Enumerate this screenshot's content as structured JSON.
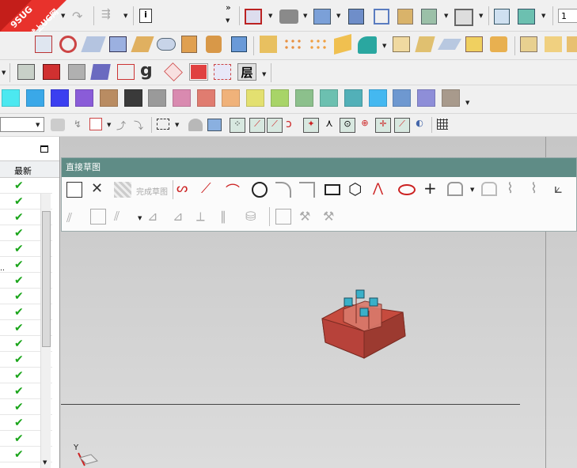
{
  "watermark": {
    "brand": "9SUG",
    "slogan": "学UG就上UG网"
  },
  "toolbar": {
    "layer_input": "1",
    "finish_sketch_label": "完成草图",
    "layer_button_glyph": "层",
    "more_glyph": "»"
  },
  "navigator": {
    "column_latest": "最新"
  },
  "sketch_panel": {
    "title": "直接草图"
  },
  "viewport": {
    "axis_label": "Y"
  },
  "colors": {
    "palette": [
      "#4ce8f0",
      "#3aa8e8",
      "#3b3ff0",
      "#8a5cd8",
      "#b98c62",
      "#3a3a3a",
      "#9a9a9a",
      "#d98ab0",
      "#e07c70",
      "#f0b27a",
      "#e3e070",
      "#a8d468",
      "#8cc08c",
      "#6cc0b0",
      "#52b0b8",
      "#44b8f0",
      "#6e98d0",
      "#8e8ed8",
      "#a89a8c"
    ],
    "accent": "#5f8c86",
    "block": "#c64b3e"
  }
}
